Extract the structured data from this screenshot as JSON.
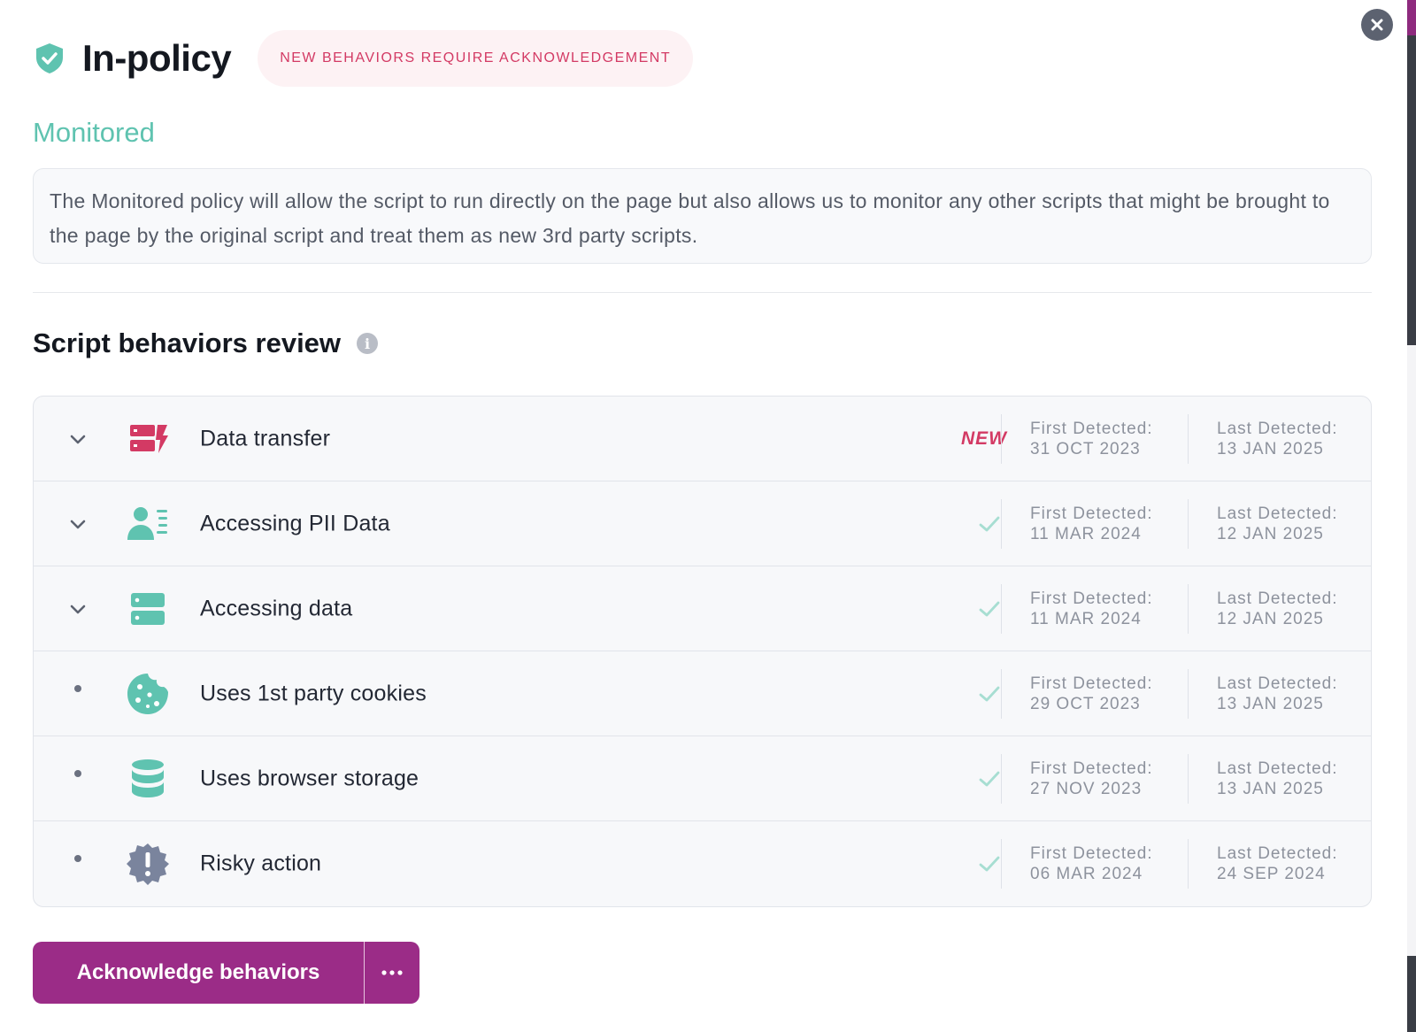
{
  "header": {
    "title": "In-policy",
    "status_pill": "NEW BEHAVIORS REQUIRE ACKNOWLEDGEMENT"
  },
  "policy": {
    "name": "Monitored",
    "description": "The Monitored policy will allow the script to run directly on the page but also allows us to monitor any other scripts that might be brought to the page by the original script and treat them as new 3rd party scripts."
  },
  "section": {
    "title": "Script behaviors review"
  },
  "behaviors": [
    {
      "label": "Data transfer",
      "status": "NEW",
      "first_label": "First Detected:",
      "first_date": "31 OCT 2023",
      "last_label": "Last Detected:",
      "last_date": "13 JAN 2025",
      "icon": "data-transfer-icon",
      "expandable": true
    },
    {
      "label": "Accessing PII Data",
      "status": "",
      "first_label": "First Detected:",
      "first_date": "11 MAR 2024",
      "last_label": "Last Detected:",
      "last_date": "12 JAN 2025",
      "icon": "user-list-icon",
      "expandable": true
    },
    {
      "label": "Accessing data",
      "status": "",
      "first_label": "First Detected:",
      "first_date": "11 MAR 2024",
      "last_label": "Last Detected:",
      "last_date": "12 JAN 2025",
      "icon": "server-icon",
      "expandable": true
    },
    {
      "label": "Uses 1st party cookies",
      "status": "",
      "first_label": "First Detected:",
      "first_date": "29 OCT 2023",
      "last_label": "Last Detected:",
      "last_date": "13 JAN 2025",
      "icon": "cookie-icon",
      "expandable": false
    },
    {
      "label": "Uses browser storage",
      "status": "",
      "first_label": "First Detected:",
      "first_date": "27 NOV 2023",
      "last_label": "Last Detected:",
      "last_date": "13 JAN 2025",
      "icon": "database-icon",
      "expandable": false
    },
    {
      "label": "Risky action",
      "status": "",
      "first_label": "First Detected:",
      "first_date": "06 MAR 2024",
      "last_label": "Last Detected:",
      "last_date": "24 SEP 2024",
      "icon": "warning-badge-icon",
      "expandable": false
    }
  ],
  "actions": {
    "acknowledge_label": "Acknowledge behaviors",
    "more_label": "..."
  },
  "colors": {
    "teal": "#5fc3b0",
    "pink": "#d33a64",
    "purple": "#9b2c87",
    "slate": "#7a849d"
  }
}
